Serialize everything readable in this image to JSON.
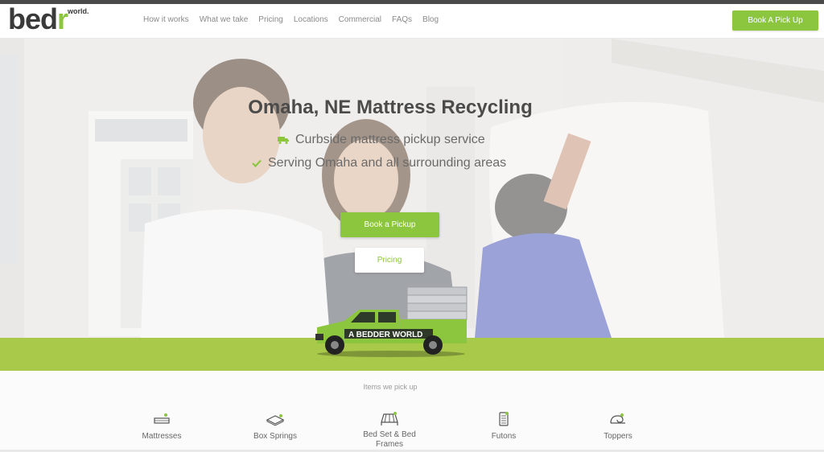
{
  "header": {
    "logo_text": "bedr",
    "logo_superscript": "world.",
    "nav": [
      "How it works",
      "What we take",
      "Pricing",
      "Locations",
      "Commercial",
      "FAQs",
      "Blog"
    ],
    "cta_label": "Book A Pick Up"
  },
  "hero": {
    "title": "Omaha, NE Mattress Recycling",
    "line1": "Curbside mattress pickup service",
    "line2": "Serving Omaha and all surrounding areas",
    "line1_icon": "truck-icon",
    "line2_icon": "check-icon",
    "primary_button": "Book a Pickup",
    "secondary_button": "Pricing"
  },
  "truck": {
    "brand": "A BEDDER WORLD"
  },
  "items": {
    "heading": "Items we pick up",
    "list": [
      {
        "label": "Mattresses",
        "icon": "mattress-icon"
      },
      {
        "label": "Box Springs",
        "icon": "box-spring-icon"
      },
      {
        "label": "Bed Set & Bed Frames",
        "icon": "bed-frame-icon"
      },
      {
        "label": "Futons",
        "icon": "futon-icon"
      },
      {
        "label": "Toppers",
        "icon": "topper-icon"
      }
    ]
  },
  "colors": {
    "brand_green": "#8cc63f",
    "band_green": "#a9c94a",
    "text_dark": "#4b4b4b"
  }
}
